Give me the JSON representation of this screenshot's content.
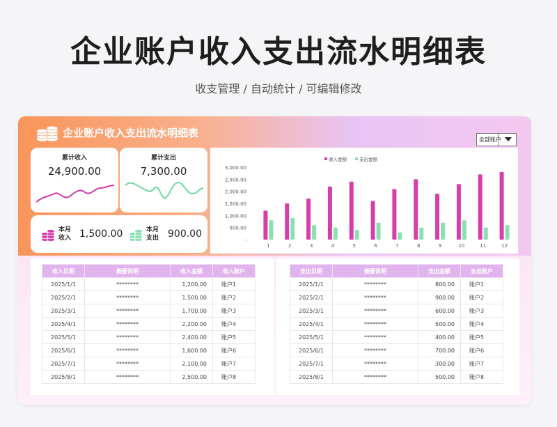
{
  "page": {
    "title": "企业账户收入支出流水明细表",
    "subtitle": "收支管理 / 自动统计 /  可编辑修改"
  },
  "dashboard": {
    "title": "企业账户收入支出流水明细表",
    "account_select": {
      "value": "全部账户"
    }
  },
  "kpis": {
    "total_income": {
      "label": "累计收入",
      "value": "24,900.00",
      "color": "#d13da6"
    },
    "total_expense": {
      "label": "累计支出",
      "value": "7,300.00",
      "color": "#6fd8a0"
    },
    "month_income": {
      "label": "本月收入",
      "value": "1,500.00"
    },
    "month_expense": {
      "label": "本月支出",
      "value": "900.00"
    }
  },
  "colors": {
    "income": "#d63fab",
    "expense": "#8be0b3",
    "header": "#e2b4ee"
  },
  "chart_data": {
    "type": "bar",
    "categories": [
      "1",
      "2",
      "3",
      "4",
      "5",
      "6",
      "7",
      "8",
      "9",
      "10",
      "11",
      "12"
    ],
    "series": [
      {
        "name": "收入金额",
        "values": [
          1200,
          1500,
          1700,
          2200,
          2400,
          1600,
          2100,
          2500,
          1900,
          2300,
          2700,
          2800
        ]
      },
      {
        "name": "支出金额",
        "values": [
          800,
          900,
          600,
          500,
          400,
          700,
          300,
          500,
          700,
          800,
          500,
          600
        ]
      }
    ],
    "ylim": [
      0,
      3000
    ],
    "yticks": [
      "3,000.00",
      "2,500.00",
      "2,000.00",
      "1,500.00",
      "1,000.00",
      "500.00",
      "-"
    ],
    "legend": "top",
    "grid": false
  },
  "income_table": {
    "headers": [
      "收入日期",
      "摘要说明",
      "收入金额",
      "收入账户"
    ],
    "rows": [
      [
        "2025/1/1",
        "********",
        "1,200.00",
        "账户1"
      ],
      [
        "2025/2/1",
        "********",
        "1,500.00",
        "账户2"
      ],
      [
        "2025/3/1",
        "********",
        "1,700.00",
        "账户3"
      ],
      [
        "2025/4/1",
        "********",
        "2,200.00",
        "账户4"
      ],
      [
        "2025/5/1",
        "********",
        "2,400.00",
        "账户5"
      ],
      [
        "2025/6/1",
        "********",
        "1,600.00",
        "账户6"
      ],
      [
        "2025/7/1",
        "********",
        "2,100.00",
        "账户7"
      ],
      [
        "2025/8/1",
        "********",
        "2,500.00",
        "账户8"
      ]
    ]
  },
  "expense_table": {
    "headers": [
      "支出日期",
      "摘要说明",
      "支出金额",
      "支出账户"
    ],
    "rows": [
      [
        "2025/1/1",
        "********",
        "800.00",
        "账户1"
      ],
      [
        "2025/2/1",
        "********",
        "900.00",
        "账户2"
      ],
      [
        "2025/3/1",
        "********",
        "600.00",
        "账户3"
      ],
      [
        "2025/4/1",
        "********",
        "500.00",
        "账户4"
      ],
      [
        "2025/5/1",
        "********",
        "400.00",
        "账户5"
      ],
      [
        "2025/6/1",
        "********",
        "700.00",
        "账户6"
      ],
      [
        "2025/7/1",
        "********",
        "300.00",
        "账户7"
      ],
      [
        "2025/8/1",
        "********",
        "500.00",
        "账户8"
      ]
    ]
  }
}
